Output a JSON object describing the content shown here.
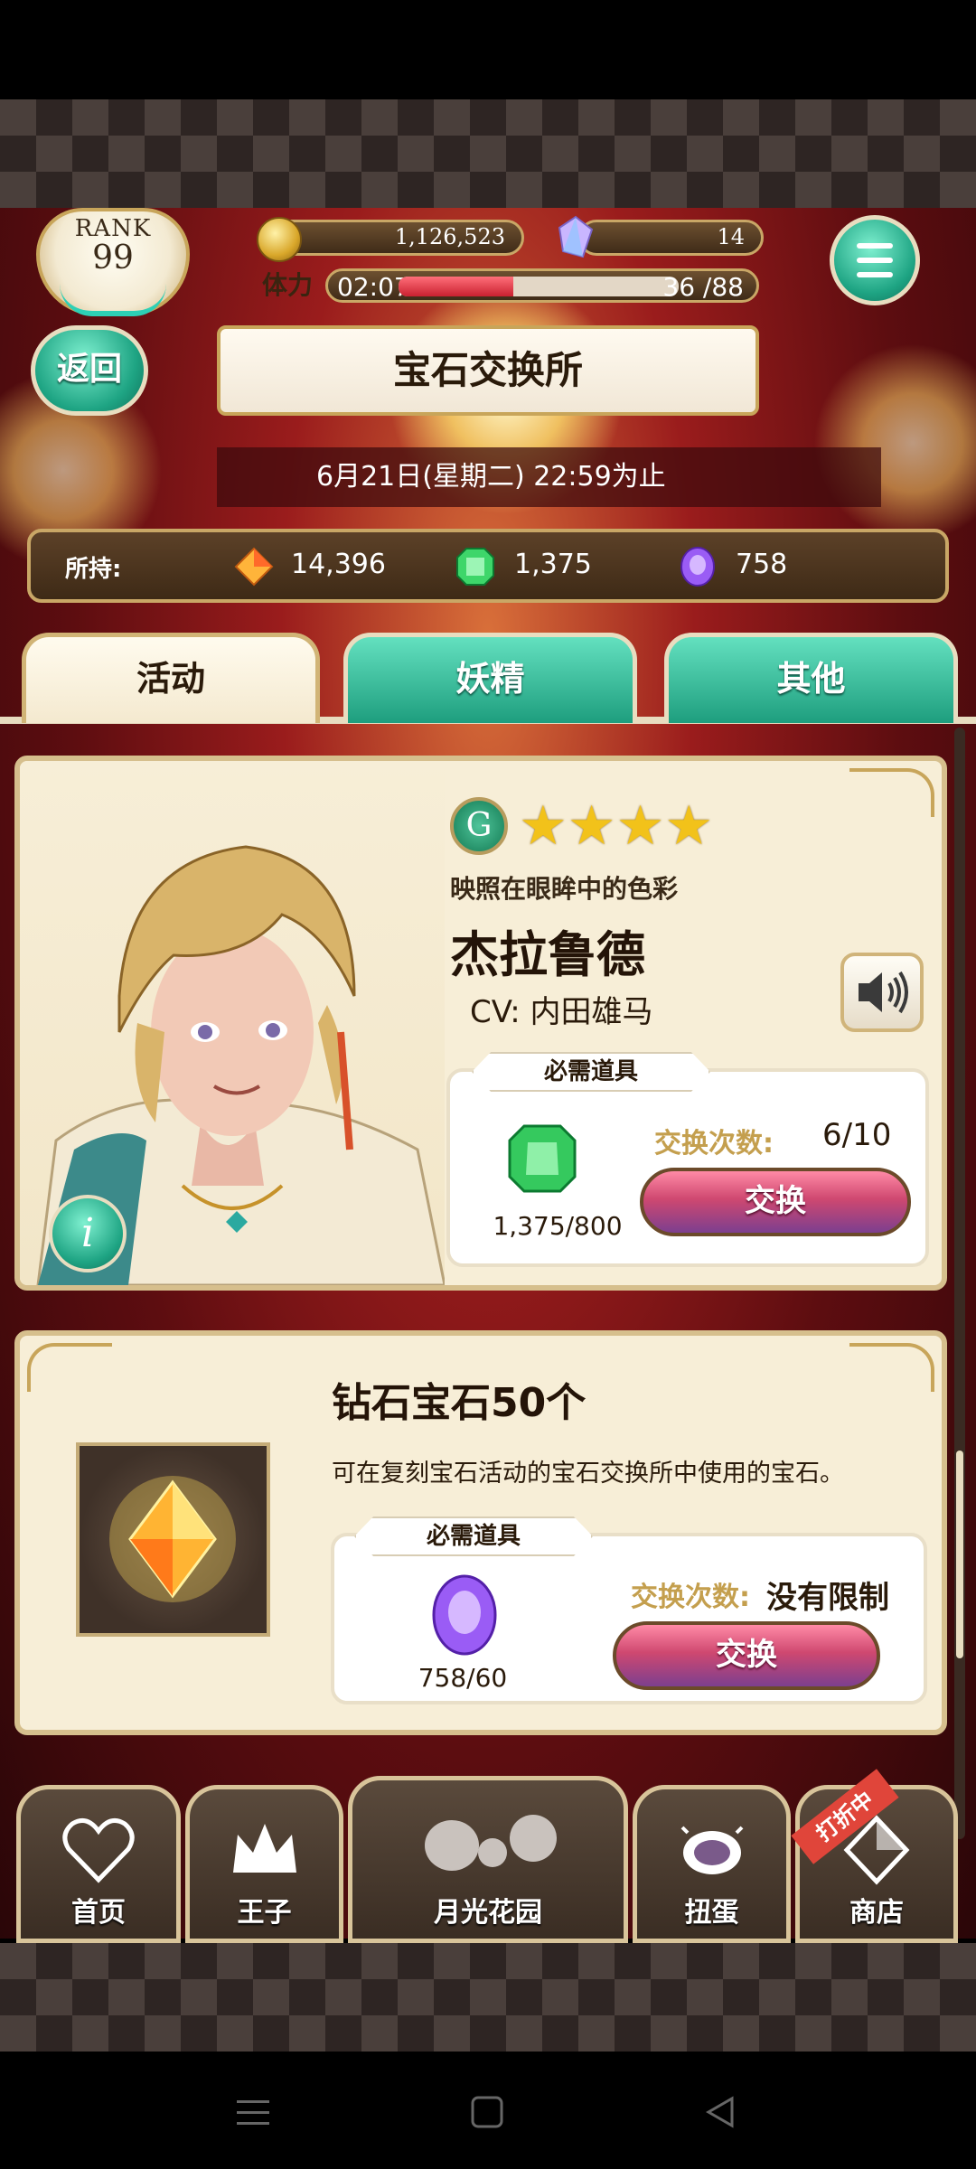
{
  "header": {
    "rank_label": "RANK",
    "rank_value": "99",
    "coins": "1,126,523",
    "gems": "14",
    "stamina_label": "体力",
    "stamina_timer": "02:07",
    "stamina_count": "36 /88",
    "stamina_fill": 0.41
  },
  "page": {
    "back_label": "返回",
    "title": "宝石交换所",
    "deadline": "6月21日(星期二) 22:59为止"
  },
  "holdings": {
    "label": "所持:",
    "orange_gem": "14,396",
    "green_gem": "1,375",
    "purple_gem": "758"
  },
  "tabs": [
    {
      "label": "活动",
      "active": true
    },
    {
      "label": "妖精",
      "active": false
    },
    {
      "label": "其他",
      "active": false
    }
  ],
  "card1": {
    "badge": "G",
    "stars": 4,
    "subtitle": "映照在眼眸中的色彩",
    "name": "杰拉鲁德",
    "cv": "CV: 内田雄马",
    "required_label": "必需道具",
    "required_qty": "1,375/800",
    "count_label": "交换次数:",
    "count_value": "6/10",
    "exchange_label": "交换",
    "info_label": "i"
  },
  "card2": {
    "title": "钻石宝石50个",
    "description": "可在复刻宝石活动的宝石交换所中使用的宝石。",
    "required_label": "必需道具",
    "required_qty": "758/60",
    "count_label": "交换次数:",
    "count_value": "没有限制",
    "exchange_label": "交换"
  },
  "bottom_nav": [
    {
      "label": "首页",
      "icon": "heart-icon"
    },
    {
      "label": "王子",
      "icon": "crown-icon"
    },
    {
      "label": "月光花园",
      "icon": "fairy-icon"
    },
    {
      "label": "扭蛋",
      "icon": "gacha-icon"
    },
    {
      "label": "商店",
      "icon": "shop-gem-icon"
    }
  ],
  "sale_badge": "打折中",
  "colors": {
    "teal_button": "#1ea483",
    "gold_border": "#c9a766",
    "card_bg": "#f7eed7",
    "exchange_pink": "#cf4870"
  }
}
